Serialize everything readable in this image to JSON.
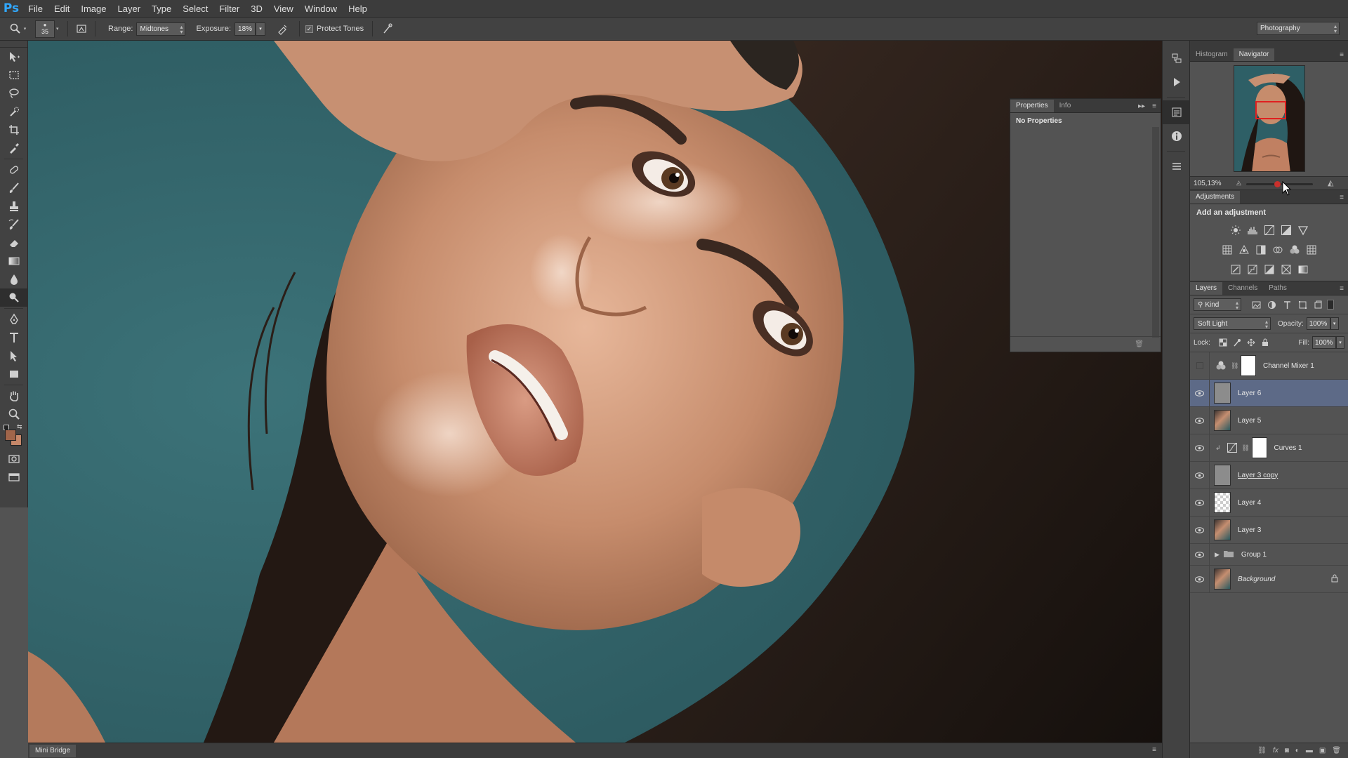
{
  "app": {
    "logo_text": "Ps"
  },
  "menu": [
    "File",
    "Edit",
    "Image",
    "Layer",
    "Type",
    "Select",
    "Filter",
    "3D",
    "View",
    "Window",
    "Help"
  ],
  "options_bar": {
    "brush_size": "35",
    "range_label": "Range:",
    "range_value": "Midtones",
    "exposure_label": "Exposure:",
    "exposure_value": "18%",
    "protect_tones_label": "Protect Tones",
    "protect_tones_checked": true,
    "workspace": "Photography"
  },
  "tools": [
    "move-tool",
    "marquee-tool",
    "lasso-tool",
    "quick-selection-tool",
    "crop-tool",
    "eyedropper-tool",
    "healing-brush-tool",
    "brush-tool",
    "clone-stamp-tool",
    "history-brush-tool",
    "eraser-tool",
    "gradient-tool",
    "blur-tool",
    "dodge-tool",
    "pen-tool",
    "type-tool",
    "path-selection-tool",
    "rectangle-tool",
    "hand-tool",
    "zoom-tool"
  ],
  "active_tool": "dodge-tool",
  "colors": {
    "foreground": "#a0654a",
    "background": "#c58769",
    "selected_layer": "#5d6a87",
    "accent_logo": "#31a8ff"
  },
  "properties_panel": {
    "tabs": [
      "Properties",
      "Info"
    ],
    "active_tab": "Properties",
    "content": "No Properties"
  },
  "navigator_panel": {
    "tabs": [
      "Histogram",
      "Navigator"
    ],
    "active_tab": "Navigator",
    "zoom": "105,13%"
  },
  "adjustments_panel": {
    "title": "Adjustments",
    "subtitle": "Add an adjustment"
  },
  "layers_panel": {
    "tabs": [
      "Layers",
      "Channels",
      "Paths"
    ],
    "active_tab": "Layers",
    "filter": "Kind",
    "blend_mode": "Soft Light",
    "opacity_label": "Opacity:",
    "opacity": "100%",
    "lock_label": "Lock:",
    "fill_label": "Fill:",
    "fill": "100%",
    "layers": [
      {
        "name": "Channel Mixer 1",
        "visible": false,
        "type": "adjustment",
        "selected": false
      },
      {
        "name": "Layer 6",
        "visible": true,
        "type": "gray",
        "selected": true
      },
      {
        "name": "Layer 5",
        "visible": true,
        "type": "photo",
        "selected": false
      },
      {
        "name": "Curves 1",
        "visible": true,
        "type": "curves",
        "selected": false
      },
      {
        "name": "Layer 3 copy",
        "visible": true,
        "type": "gray",
        "selected": false
      },
      {
        "name": "Layer 4",
        "visible": true,
        "type": "checker",
        "selected": false
      },
      {
        "name": "Layer 3",
        "visible": true,
        "type": "photo",
        "selected": false
      },
      {
        "name": "Group 1",
        "visible": true,
        "type": "group",
        "selected": false
      },
      {
        "name": "Background",
        "visible": true,
        "type": "photo",
        "selected": false,
        "locked": true
      }
    ]
  },
  "mini_bridge": {
    "label": "Mini Bridge"
  }
}
